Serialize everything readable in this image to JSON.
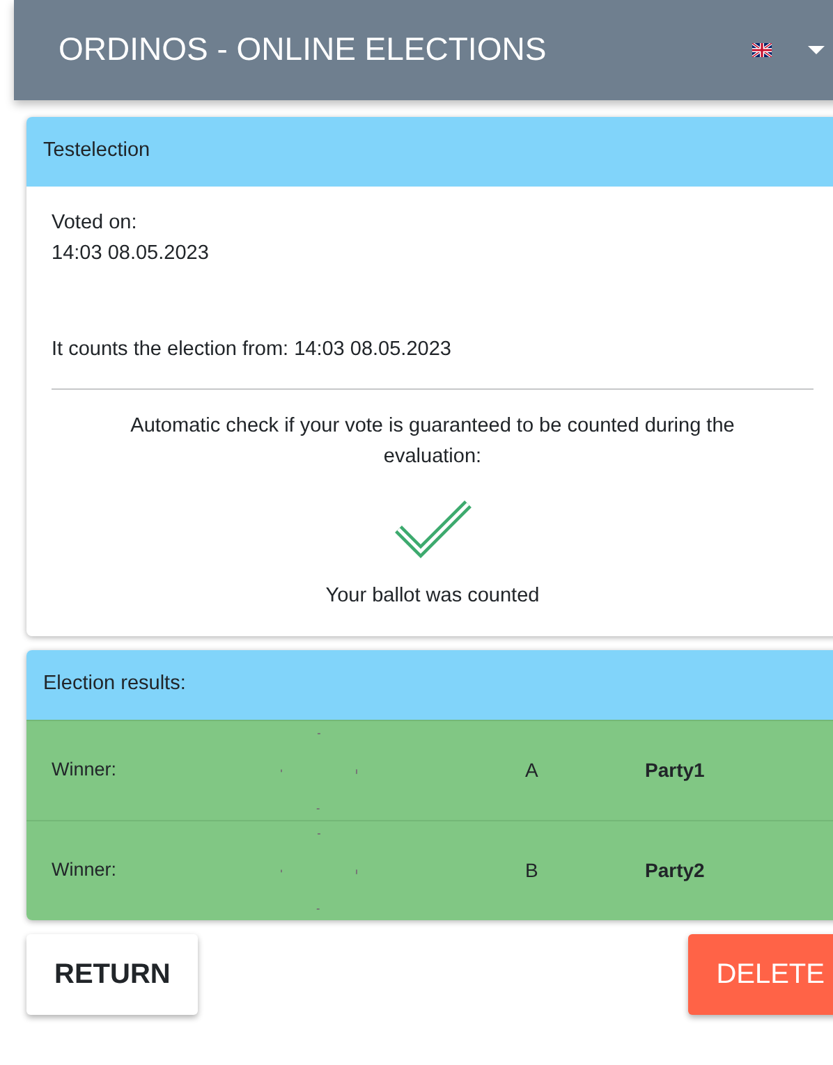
{
  "header": {
    "title": "ORDINOS - ONLINE ELECTIONS"
  },
  "election": {
    "title": "Testelection",
    "voted_label": "Voted on:",
    "voted_time": "14:03 08.05.2023",
    "counts_text": "It counts the election from: 14:03 08.05.2023",
    "check_text": "Automatic check if your vote is guaranteed to be counted during the evaluation:",
    "checked": true,
    "result_text": "Your ballot was counted"
  },
  "results": {
    "title": "Election results:",
    "rows": [
      {
        "label": "Winner:",
        "letter": "A",
        "party": "Party1"
      },
      {
        "label": "Winner:",
        "letter": "B",
        "party": "Party2"
      }
    ]
  },
  "buttons": [
    {
      "label": "RETURN",
      "kind": "plain"
    },
    {
      "label": "DELETE",
      "kind": "danger"
    }
  ]
}
